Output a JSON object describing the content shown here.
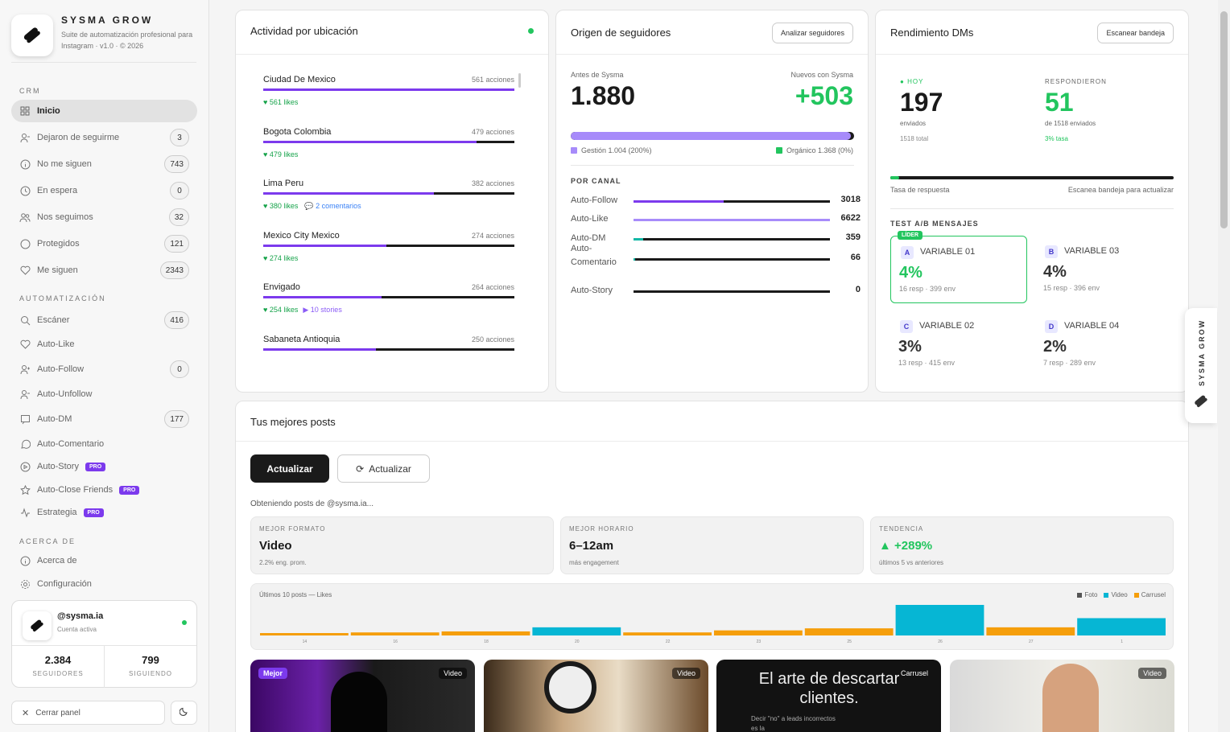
{
  "brand": {
    "name": "SYSMA GROW",
    "sub": "Suite de automatización profesional para Instagram · v1.0 · © 2026"
  },
  "sections": {
    "crm": "CRM",
    "auto": "AUTOMATIZACIÓN",
    "about": "ACERCA DE"
  },
  "nav": [
    {
      "label": "Inicio",
      "count": "",
      "icon": "grid-icon"
    },
    {
      "label": "Dejaron de seguirme",
      "count": "3",
      "icon": "user-minus-icon"
    },
    {
      "label": "No me siguen",
      "count": "743",
      "icon": "info-icon"
    },
    {
      "label": "En espera",
      "count": "0",
      "icon": "clock-icon"
    },
    {
      "label": "Nos seguimos",
      "count": "32",
      "icon": "users-icon"
    },
    {
      "label": "Protegidos",
      "count": "121",
      "icon": "shield-icon"
    },
    {
      "label": "Me siguen",
      "count": "2343",
      "icon": "heart-icon"
    }
  ],
  "auto": [
    {
      "label": "Escáner",
      "count": "416",
      "icon": "search-icon",
      "pro": ""
    },
    {
      "label": "Auto-Like",
      "count": "",
      "icon": "heart-icon",
      "pro": ""
    },
    {
      "label": "Auto-Follow",
      "count": "0",
      "icon": "user-plus-icon",
      "pro": ""
    },
    {
      "label": "Auto-Unfollow",
      "count": "",
      "icon": "user-minus-icon",
      "pro": ""
    },
    {
      "label": "Auto-DM",
      "count": "177",
      "icon": "message-icon",
      "pro": ""
    },
    {
      "label": "Auto-Comentario",
      "count": "",
      "icon": "comment-icon",
      "pro": ""
    },
    {
      "label": "Auto-Story",
      "count": "",
      "icon": "play-icon",
      "pro": "PRO"
    },
    {
      "label": "Auto-Close Friends",
      "count": "",
      "icon": "star-icon",
      "pro": "PRO"
    },
    {
      "label": "Estrategia",
      "count": "",
      "icon": "activity-icon",
      "pro": "PRO"
    }
  ],
  "about": [
    {
      "label": "Acerca de",
      "icon": "info-icon"
    },
    {
      "label": "Configuración",
      "icon": "gear-icon"
    }
  ],
  "account": {
    "handle": "@sysma.ia",
    "status": "Cuenta activa",
    "followers": "2.384",
    "followers_label": "SEGUIDORES",
    "following": "799",
    "following_label": "SIGUIENDO"
  },
  "close_panel": "Cerrar panel",
  "activity": {
    "title": "Actividad por ubicación",
    "items": [
      {
        "name": "Ciudad De Mexico",
        "actions": "561 acciones",
        "likes": "♥ 561 likes",
        "comments": "",
        "stories": "",
        "pct": 100
      },
      {
        "name": "Bogota Colombia",
        "actions": "479 acciones",
        "likes": "♥ 479 likes",
        "comments": "",
        "stories": "",
        "pct": 85
      },
      {
        "name": "Lima Peru",
        "actions": "382 acciones",
        "likes": "♥ 380 likes",
        "comments": "2 comentarios",
        "stories": "",
        "pct": 68
      },
      {
        "name": "Mexico City Mexico",
        "actions": "274 acciones",
        "likes": "♥ 274 likes",
        "comments": "",
        "stories": "",
        "pct": 49
      },
      {
        "name": "Envigado",
        "actions": "264 acciones",
        "likes": "♥ 254 likes",
        "comments": "",
        "stories": "▶ 10 stories",
        "pct": 47
      },
      {
        "name": "Sabaneta Antioquia",
        "actions": "250 acciones",
        "likes": "",
        "comments": "",
        "stories": "",
        "pct": 45
      }
    ]
  },
  "followers": {
    "title": "Origen de seguidores",
    "button": "Analizar seguidores",
    "before_label": "Antes de Sysma",
    "before": "1.880",
    "new_label": "Nuevos con Sysma",
    "new": "+503",
    "gestion": "Gestión 1.004 (200%)",
    "organico": "Orgánico 1.368 (0%)",
    "channel_title": "POR CANAL",
    "channels": [
      {
        "name": "Auto-Follow",
        "value": "3018",
        "pct": 46,
        "color": "#7c3aed"
      },
      {
        "name": "Auto-Like",
        "value": "6622",
        "pct": 100,
        "color": "#a78bfa"
      },
      {
        "name": "Auto-DM",
        "value": "359",
        "pct": 5,
        "color": "#14b8a6"
      },
      {
        "name": "Auto-Comentario",
        "value": "66",
        "pct": 1,
        "color": "#14b8a6"
      },
      {
        "name": "Auto-Story",
        "value": "0",
        "pct": 0,
        "color": "#14b8a6"
      }
    ]
  },
  "dms": {
    "title": "Rendimiento DMs",
    "button": "Escanear bandeja",
    "today_label": "HOY",
    "today": "197",
    "today_sub": "enviados",
    "today_total": "1518 total",
    "resp_label": "RESPONDIERON",
    "resp": "51",
    "resp_sub": "de 1518 enviados",
    "resp_rate": "3% tasa",
    "rate_label": "Tasa de respuesta",
    "rate_hint": "Escanea bandeja para actualizar",
    "rate_pct": 3,
    "ab_title": "TEST A/B MENSAJES",
    "leader": "LÍDER",
    "variants": [
      {
        "tag": "A",
        "name": "VARIABLE 01",
        "pct": "4%",
        "sub": "16 resp · 399 env"
      },
      {
        "tag": "B",
        "name": "VARIABLE 03",
        "pct": "4%",
        "sub": "15 resp · 396 env"
      },
      {
        "tag": "C",
        "name": "VARIABLE 02",
        "pct": "3%",
        "sub": "13 resp · 415 env"
      },
      {
        "tag": "D",
        "name": "VARIABLE 04",
        "pct": "2%",
        "sub": "7 resp · 289 env"
      }
    ]
  },
  "posts": {
    "title": "Tus mejores posts",
    "btn1": "Actualizar",
    "btn2": "Actualizar",
    "loading": "Obteniendo posts de @sysma.ia...",
    "best_format_label": "MEJOR FORMATO",
    "best_format": "Video",
    "best_format_sub": "2.2% eng. prom.",
    "best_time_label": "MEJOR HORARIO",
    "best_time": "6–12am",
    "best_time_sub": "más engagement",
    "trend_label": "TENDENCIA",
    "trend": "▲ +289%",
    "trend_sub": "últimos 5 vs anteriores",
    "thumbs": [
      {
        "badge": "Mejor",
        "type": "Video"
      },
      {
        "badge": "",
        "type": "Video"
      },
      {
        "badge": "",
        "type": "Carrusel",
        "title": "El arte de descartar clientes.",
        "text": "Decir \"no\" a leads incorrectos es la"
      },
      {
        "badge": "",
        "type": "Video"
      }
    ]
  },
  "side_tab": "SYSMA GROW",
  "chart_data": {
    "type": "bar",
    "title": "Últimos 10 posts — Likes",
    "categories": [
      "14",
      "16",
      "18",
      "20",
      "22",
      "23",
      "25",
      "26",
      "27",
      "1"
    ],
    "types": [
      "Carrusel",
      "Carrusel",
      "Carrusel",
      "Video",
      "Carrusel",
      "Carrusel",
      "Carrusel",
      "Video",
      "Carrusel",
      "Video"
    ],
    "values": [
      2,
      3,
      4,
      8,
      3,
      5,
      7,
      30,
      8,
      17
    ],
    "legend": [
      "Foto",
      "Video",
      "Carrusel"
    ],
    "colors": {
      "Foto": "#555555",
      "Video": "#06b6d4",
      "Carrusel": "#f59e0b"
    }
  }
}
